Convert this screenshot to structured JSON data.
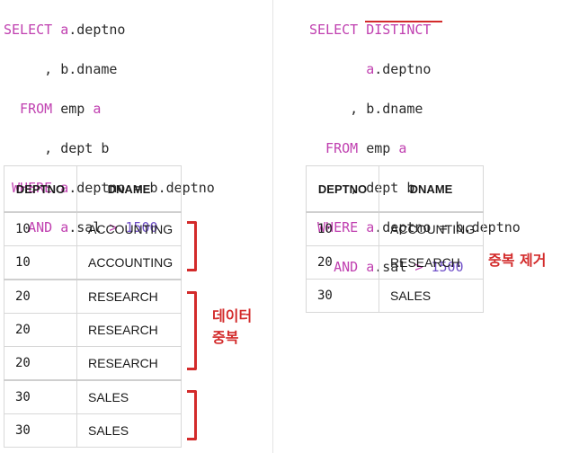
{
  "left_query": {
    "select_kw": "SELECT",
    "lines": [
      {
        "kw": "SELECT",
        "alias": "a",
        "rest": ".deptno"
      },
      {
        "kw": "     ,",
        "alias": "",
        "rest": " b.dname"
      },
      {
        "kw": "  FROM",
        "alias": "",
        "rest": " emp a"
      },
      {
        "kw": "     ,",
        "alias": "",
        "rest": " dept b"
      },
      {
        "kw": " WHERE",
        "alias": "a",
        "rest": ".deptno = b.deptno"
      },
      {
        "kw": "   AND",
        "alias": "a",
        "rest": ".sal > 1500"
      }
    ]
  },
  "right_query": {
    "select_kw": "SELECT",
    "distinct_kw": "DISTINCT",
    "col1": "a.deptno",
    "col2_prefix": ", b.dname",
    "from_kw": "FROM",
    "from_rest": "emp a",
    "join_prefix": ", dept b",
    "where_kw": "WHERE",
    "where_rest": "a.deptno = b.deptno",
    "and_kw": "AND",
    "and_alias": "a",
    "and_col": ".sal",
    "and_op": ">",
    "and_num": "1500"
  },
  "left_table": {
    "headers": [
      "DEPTNO",
      "DNAME"
    ],
    "rows": [
      [
        "10",
        "ACCOUNTING"
      ],
      [
        "10",
        "ACCOUNTING"
      ],
      [
        "20",
        "RESEARCH"
      ],
      [
        "20",
        "RESEARCH"
      ],
      [
        "20",
        "RESEARCH"
      ],
      [
        "30",
        "SALES"
      ],
      [
        "30",
        "SALES"
      ]
    ]
  },
  "right_table": {
    "headers": [
      "DEPTNO",
      "DNAME"
    ],
    "rows": [
      [
        "10",
        "ACCOUNTING"
      ],
      [
        "20",
        "RESEARCH"
      ],
      [
        "30",
        "SALES"
      ]
    ]
  },
  "annotations": {
    "duplicate_line1": "데이터",
    "duplicate_line2": "중복",
    "dedupe": "중복 제거"
  },
  "colors": {
    "keyword": "#c040b0",
    "number": "#7050c8",
    "annotation": "#d32b2b"
  }
}
